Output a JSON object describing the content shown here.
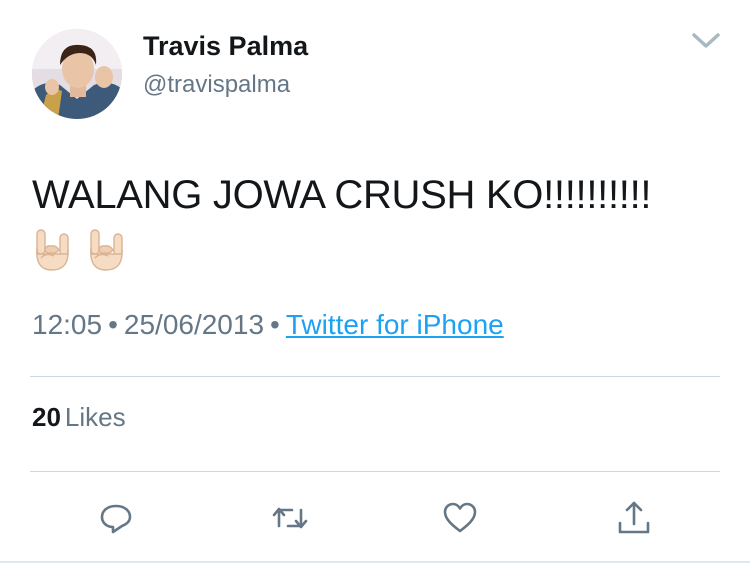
{
  "tweet": {
    "display_name": "Travis Palma",
    "handle": "@travispalma",
    "text": "WALANG JOWA CRUSH KO!!!!!!!!!!",
    "emojis": [
      "sign-of-the-horns",
      "sign-of-the-horns"
    ],
    "time": "12:05",
    "date": "25/06/2013",
    "separator": "•",
    "source": "Twitter for iPhone",
    "likes_count": "20",
    "likes_label": "Likes"
  },
  "icons": {
    "menu": "chevron-down-icon",
    "reply": "reply-icon",
    "retweet": "retweet-icon",
    "like": "heart-icon",
    "share": "share-icon"
  },
  "colors": {
    "text_primary": "#14171a",
    "text_secondary": "#657786",
    "link": "#1da1f2",
    "divider": "#ccd6dd",
    "icon": "#657786"
  }
}
